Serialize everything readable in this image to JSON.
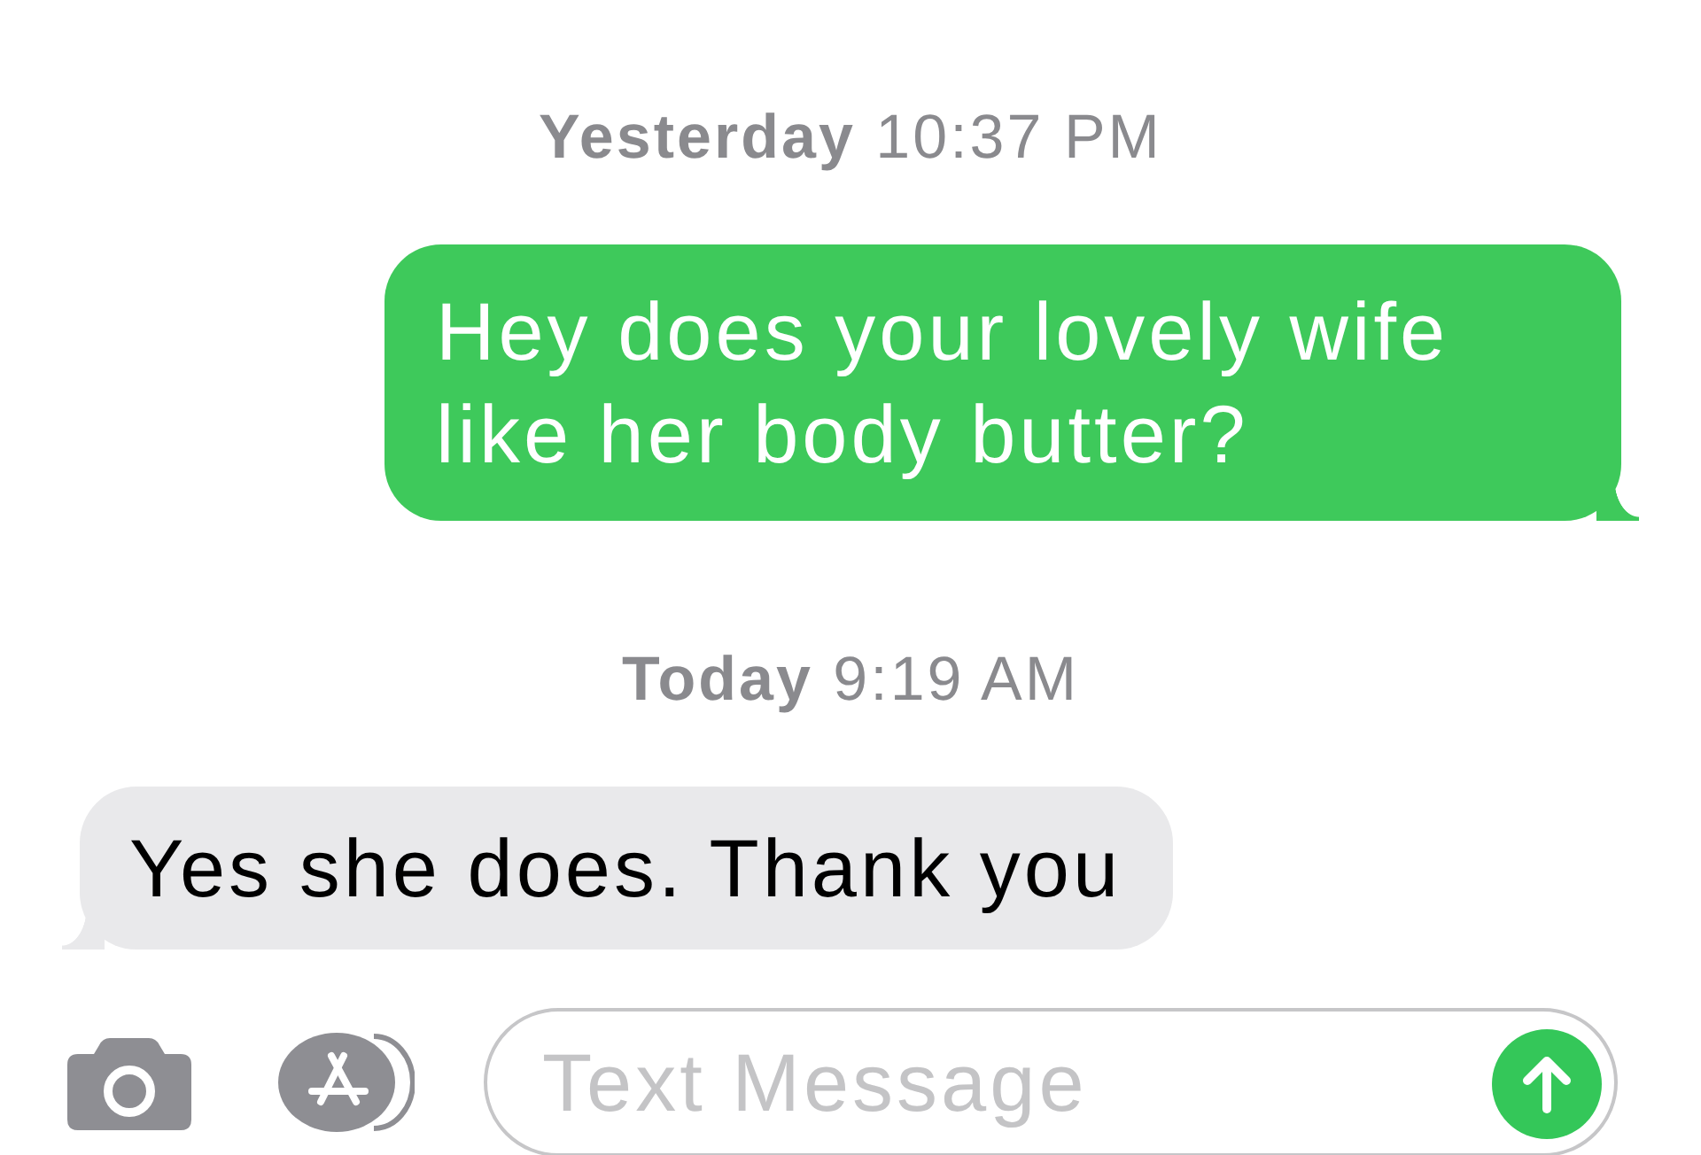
{
  "messages": [
    {
      "kind": "timestamp",
      "text": "**Yesterday** 10:37 PM"
    },
    {
      "kind": "sent",
      "text": "Hey does your lovely wife like her body butter?"
    },
    {
      "kind": "timestamp",
      "text": "**Today** 9:19 AM"
    },
    {
      "kind": "received",
      "text": "Yes she does. Thank you"
    }
  ],
  "compose_bar": {
    "placeholder": "Text Message"
  }
}
